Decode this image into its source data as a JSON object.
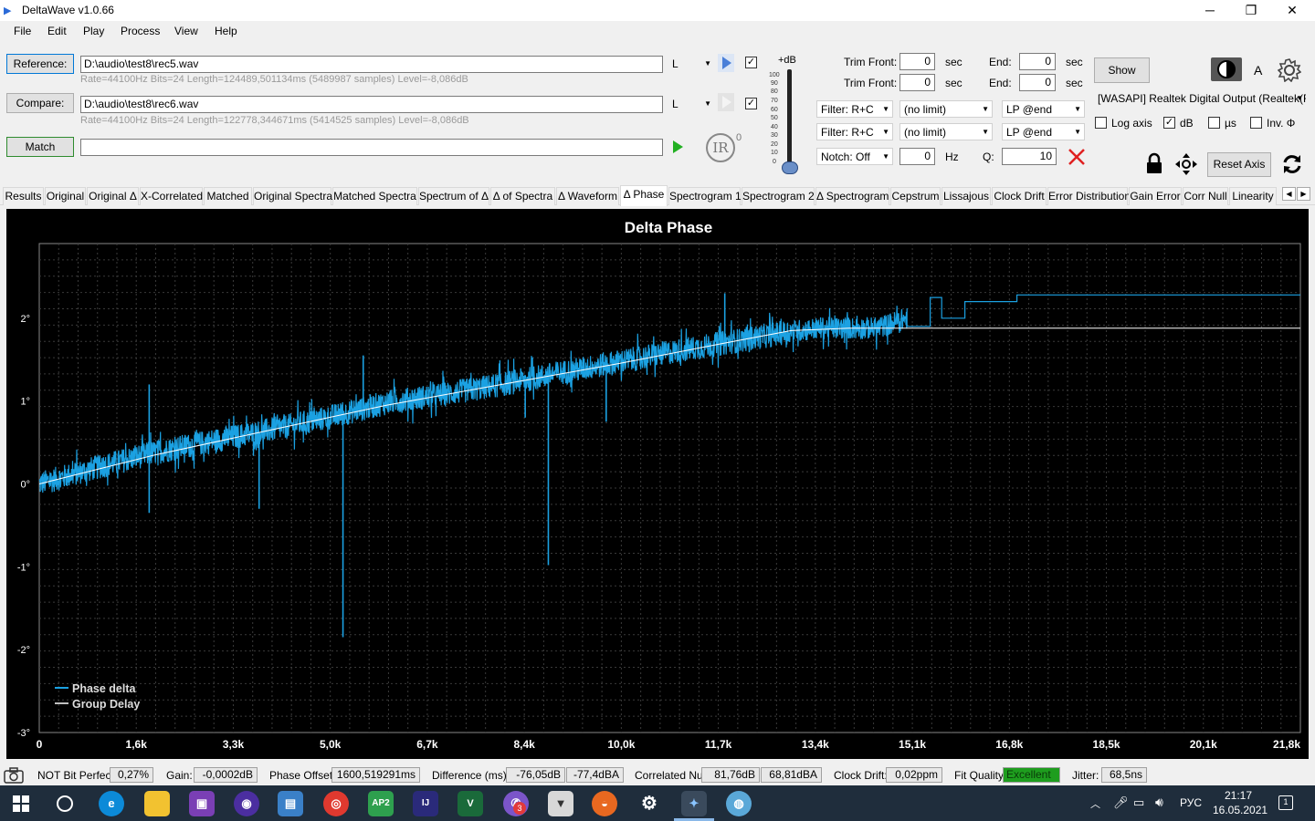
{
  "window": {
    "title": "DeltaWave v1.0.66",
    "minimize": "─",
    "restore": "❐",
    "close": "✕"
  },
  "menu": [
    "File",
    "Edit",
    "Play",
    "Process",
    "View",
    "Help"
  ],
  "reference": {
    "button": "Reference:",
    "path": "D:\\audio\\test8\\rec5.wav",
    "info": "Rate=44100Hz Bits=24 Length=124489,501134ms (5489987 samples) Level=-8,086dB",
    "channel": "L",
    "checked": "✓"
  },
  "compare": {
    "button": "Compare:",
    "path": "D:\\audio\\test8\\rec6.wav",
    "info": "Rate=44100Hz Bits=24 Length=122778,344671ms (5414525 samples) Level=-8,086dB",
    "channel": "L",
    "checked": "✓"
  },
  "match": {
    "button": "Match",
    "value": ""
  },
  "ir": {
    "label": "IR",
    "sup": "0"
  },
  "volume": {
    "label": "+dB",
    "ticks": [
      "100",
      "90",
      "80",
      "70",
      "60",
      "50",
      "40",
      "30",
      "20",
      "10",
      "0"
    ]
  },
  "trim": {
    "front_label": "Trim Front:",
    "front1": "0",
    "front2": "0",
    "sec": "sec",
    "end_label": "End:",
    "end1": "0",
    "end2": "0"
  },
  "filters": {
    "row1": {
      "type": "Filter: R+C",
      "limit": "(no limit)",
      "lp": "LP @end"
    },
    "row2": {
      "type": "Filter: R+C",
      "limit": "(no limit)",
      "lp": "LP @end"
    },
    "notch": {
      "type": "Notch: Off",
      "hz_value": "0",
      "hz": "Hz",
      "q_label": "Q:",
      "q_value": "10"
    }
  },
  "right_panel": {
    "show": "Show",
    "a_label": "A",
    "device": "[WASAPI] Realtek Digital Output (Realtek(R",
    "log_axis": "Log axis",
    "db": "dB",
    "us": "µs",
    "inv": "Inv. Φ",
    "db_checked": "✓",
    "reset_axis": "Reset Axis"
  },
  "tabs": [
    "Results",
    "Original",
    "Original Δ",
    "X-Correlated",
    "Matched",
    "Original Spectra",
    "Matched Spectra",
    "Spectrum of Δ",
    "Δ of Spectra",
    "Δ Waveform",
    "Δ Phase",
    "Spectrogram 1",
    "Spectrogram 2",
    "Δ Spectrogram",
    "Cepstrum",
    "Lissajous",
    "Clock Drift",
    "Error Distribution",
    "Gain Error",
    "Corr Null",
    "Linearity"
  ],
  "selected_tab": "Δ Phase",
  "chart_data": {
    "type": "line",
    "title": "Delta Phase",
    "x_tick_labels": [
      "0",
      "1,6k",
      "3,3k",
      "5,0k",
      "6,7k",
      "8,4k",
      "10,0k",
      "11,7k",
      "13,4k",
      "15,1k",
      "16,8k",
      "18,5k",
      "20,1k",
      "21,8k"
    ],
    "y_tick_labels": [
      "2°",
      "1°",
      "0°",
      "-1°",
      "-2°",
      "-3°"
    ],
    "xlim": [
      0,
      21800
    ],
    "ylim": [
      -3,
      2.9
    ],
    "grid": true,
    "legend_position": "bottom-left",
    "series": [
      {
        "name": "Phase delta",
        "color": "#1ba1e2",
        "x": [
          0,
          1000,
          2000,
          3000,
          4000,
          5000,
          6000,
          7000,
          8000,
          9000,
          10000,
          11000,
          12000,
          13000,
          13500,
          14000,
          14500,
          15000,
          15300,
          15500,
          16000,
          16500,
          16900,
          17000,
          18000,
          20000,
          21800
        ],
        "y": [
          0.0,
          0.2,
          0.38,
          0.52,
          0.65,
          0.8,
          0.98,
          1.08,
          1.2,
          1.34,
          1.47,
          1.6,
          1.72,
          1.84,
          1.88,
          1.88,
          1.88,
          2.0,
          2.25,
          2.0,
          2.2,
          2.2,
          2.2,
          2.28,
          2.28,
          2.28,
          2.28
        ],
        "noise_amplitude": 0.15,
        "spikes": [
          {
            "x": 1900,
            "y": 1.2
          },
          {
            "x": 1900,
            "y": -0.35
          },
          {
            "x": 3800,
            "y": -0.3
          },
          {
            "x": 5250,
            "y": -1.85
          },
          {
            "x": 5600,
            "y": 1.55
          },
          {
            "x": 8800,
            "y": -0.98
          },
          {
            "x": 11850,
            "y": 2.3
          },
          {
            "x": 8400,
            "y": 0.8
          },
          {
            "x": 9800,
            "y": 0.75
          }
        ]
      },
      {
        "name": "Group Delay",
        "color": "#ffffff",
        "x": [
          0,
          2000,
          4000,
          6000,
          8000,
          10000,
          12000,
          13000,
          14000,
          21800
        ],
        "y": [
          0.0,
          0.35,
          0.65,
          0.95,
          1.2,
          1.45,
          1.72,
          1.85,
          1.88,
          1.88
        ]
      }
    ]
  },
  "status": {
    "bit_perfect": "NOT Bit Perfect",
    "bit_perfect_value": "0,27%",
    "gain_label": "Gain:",
    "gain": "-0,0002dB",
    "phase_label": "Phase Offset:",
    "phase": "1600,519291ms",
    "diff_label": "Difference (ms):",
    "diff1": "-76,05dB",
    "diff2": "-77,4dBA",
    "null_label": "Correlated Null:",
    "null1": "81,76dB",
    "null2": "68,81dBA",
    "drift_label": "Clock Drift:",
    "drift": "0,02ppm",
    "fit_label": "Fit Quality:",
    "fit": "Excellent",
    "jitter_label": "Jitter:",
    "jitter": "68,5ns"
  },
  "taskbar": {
    "lang": "РУС",
    "time": "21:17",
    "date": "16.05.2021",
    "notif": "1",
    "badge": "3",
    "apps": [
      "start",
      "search",
      "edge",
      "explorer",
      "save",
      "audacity",
      "files",
      "chrome",
      "ap2",
      "jetbrains",
      "visualgdb",
      "viber",
      "fox",
      "orange",
      "settings",
      "deltawave",
      "paint"
    ]
  },
  "colors": {
    "accent": "#0078d7",
    "plot_bg": "#000000",
    "phase": "#1ba1e2",
    "fit_ok": "#1e9d1e"
  }
}
